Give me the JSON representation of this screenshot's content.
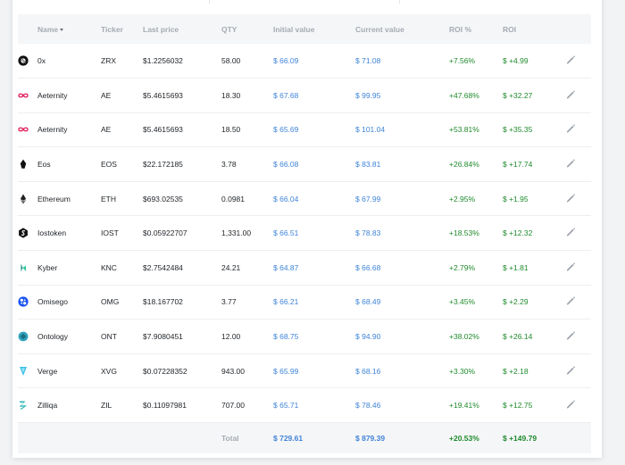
{
  "table": {
    "columns": {
      "name": "Name",
      "ticker": "Ticker",
      "last_price": "Last price",
      "qty": "QTY",
      "initial_value": "Initial value",
      "current_value": "Current value",
      "roi_pct": "ROI %",
      "roi": "ROI"
    },
    "rows": [
      {
        "icon": "0x-icon",
        "name": "0x",
        "ticker": "ZRX",
        "last_price": "$1.2256032",
        "qty": "58.00",
        "initial_value": "$ 66.09",
        "current_value": "$ 71.08",
        "roi_pct": "+7.56%",
        "roi": "$ +4.99"
      },
      {
        "icon": "aeternity-icon",
        "name": "Aeternity",
        "ticker": "AE",
        "last_price": "$5.4615693",
        "qty": "18.30",
        "initial_value": "$ 67.68",
        "current_value": "$ 99.95",
        "roi_pct": "+47.68%",
        "roi": "$ +32.27"
      },
      {
        "icon": "aeternity-icon",
        "name": "Aeternity",
        "ticker": "AE",
        "last_price": "$5.4615693",
        "qty": "18.50",
        "initial_value": "$ 65.69",
        "current_value": "$ 101.04",
        "roi_pct": "+53.81%",
        "roi": "$ +35.35"
      },
      {
        "icon": "eos-icon",
        "name": "Eos",
        "ticker": "EOS",
        "last_price": "$22.172185",
        "qty": "3.78",
        "initial_value": "$ 66.08",
        "current_value": "$ 83.81",
        "roi_pct": "+26.84%",
        "roi": "$ +17.74"
      },
      {
        "icon": "ethereum-icon",
        "name": "Ethereum",
        "ticker": "ETH",
        "last_price": "$693.02535",
        "qty": "0.0981",
        "initial_value": "$ 66.04",
        "current_value": "$ 67.99",
        "roi_pct": "+2.95%",
        "roi": "$ +1.95"
      },
      {
        "icon": "iostoken-icon",
        "name": "Iostoken",
        "ticker": "IOST",
        "last_price": "$0.05922707",
        "qty": "1,331.00",
        "initial_value": "$ 66.51",
        "current_value": "$ 78.83",
        "roi_pct": "+18.53%",
        "roi": "$ +12.32"
      },
      {
        "icon": "kyber-icon",
        "name": "Kyber",
        "ticker": "KNC",
        "last_price": "$2.7542484",
        "qty": "24.21",
        "initial_value": "$ 64.87",
        "current_value": "$ 66.68",
        "roi_pct": "+2.79%",
        "roi": "$ +1.81"
      },
      {
        "icon": "omisego-icon",
        "name": "Omisego",
        "ticker": "OMG",
        "last_price": "$18.167702",
        "qty": "3.77",
        "initial_value": "$ 66.21",
        "current_value": "$ 68.49",
        "roi_pct": "+3.45%",
        "roi": "$ +2.29"
      },
      {
        "icon": "ontology-icon",
        "name": "Ontology",
        "ticker": "ONT",
        "last_price": "$7.9080451",
        "qty": "12.00",
        "initial_value": "$ 68.75",
        "current_value": "$ 94.90",
        "roi_pct": "+38.02%",
        "roi": "$ +26.14"
      },
      {
        "icon": "verge-icon",
        "name": "Verge",
        "ticker": "XVG",
        "last_price": "$0.07228352",
        "qty": "943.00",
        "initial_value": "$ 65.99",
        "current_value": "$ 68.16",
        "roi_pct": "+3.30%",
        "roi": "$ +2.18"
      },
      {
        "icon": "zilliqa-icon",
        "name": "Zilliqa",
        "ticker": "ZIL",
        "last_price": "$0.11097981",
        "qty": "707.00",
        "initial_value": "$ 65.71",
        "current_value": "$ 78.46",
        "roi_pct": "+19.41%",
        "roi": "$ +12.75"
      }
    ],
    "total": {
      "label": "Total",
      "initial_value": "$ 729.61",
      "current_value": "$ 879.39",
      "roi_pct": "+20.53%",
      "roi": "$ +149.79"
    }
  },
  "colors": {
    "blue": "#3f84d8",
    "green": "#1f8a2c",
    "header_text": "#a5abb3",
    "header_bg": "#f5f6f8"
  }
}
